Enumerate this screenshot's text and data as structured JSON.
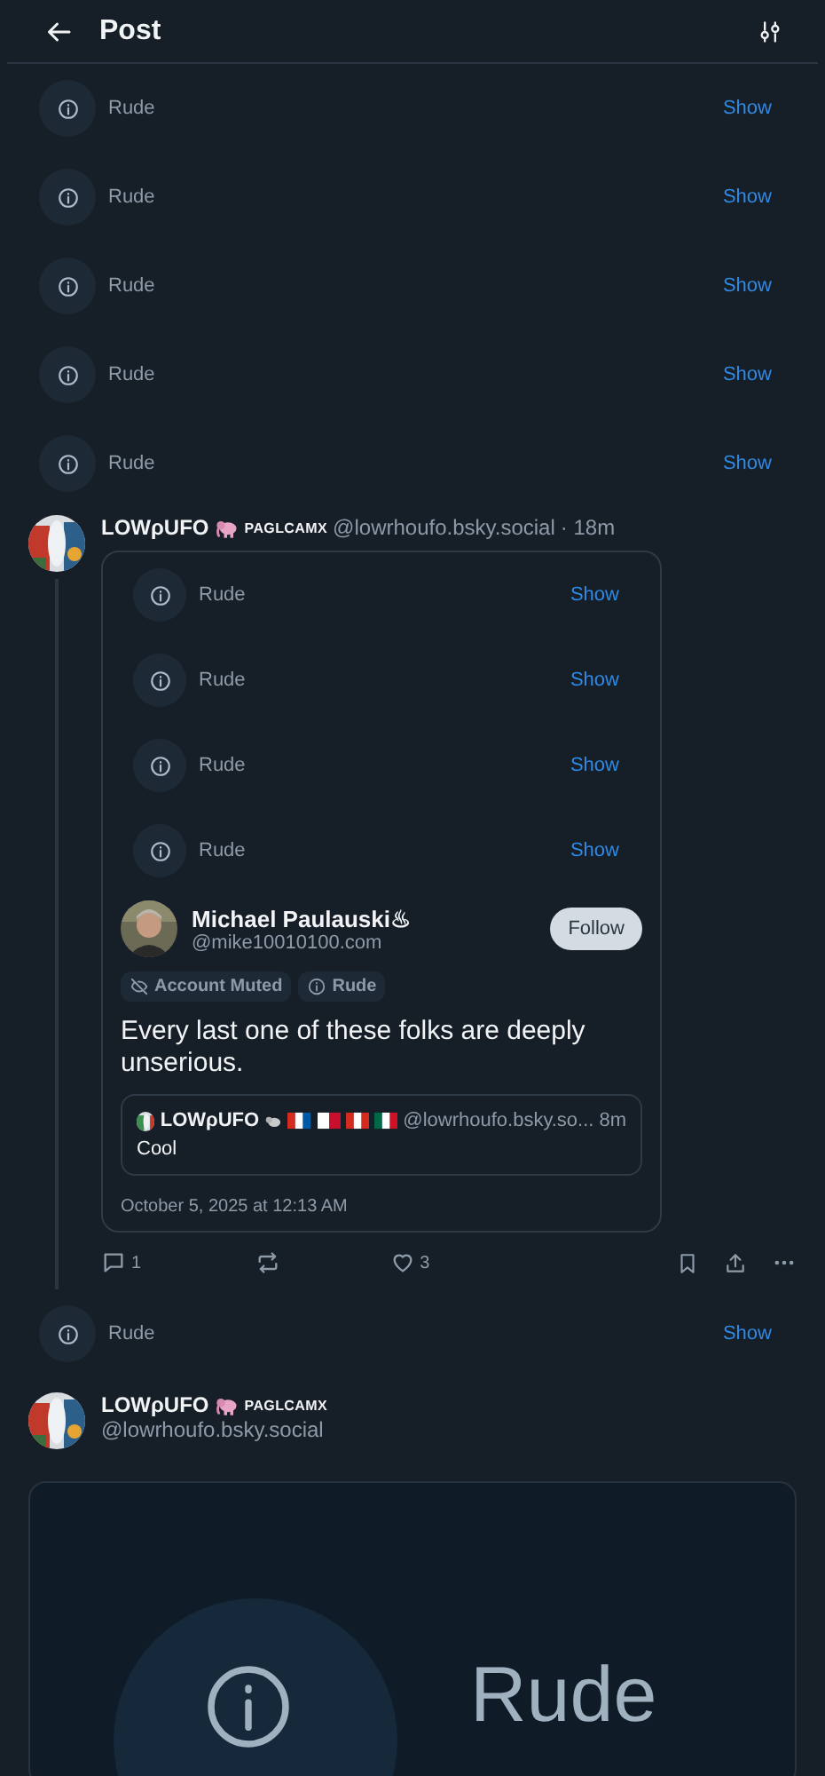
{
  "header": {
    "title": "Post"
  },
  "hidden_replies": [
    {
      "label": "Rude",
      "action": "Show"
    },
    {
      "label": "Rude",
      "action": "Show"
    },
    {
      "label": "Rude",
      "action": "Show"
    },
    {
      "label": "Rude",
      "action": "Show"
    },
    {
      "label": "Rude",
      "action": "Show"
    }
  ],
  "post": {
    "display_name": "LOWρUFO",
    "badge_text": "PAGLCAMX",
    "handle": "@lowrhoufo.bsky.social",
    "time": "· 18m",
    "quote": {
      "hidden_replies": [
        {
          "label": "Rude",
          "action": "Show"
        },
        {
          "label": "Rude",
          "action": "Show"
        },
        {
          "label": "Rude",
          "action": "Show"
        },
        {
          "label": "Rude",
          "action": "Show"
        }
      ],
      "author": {
        "display_name": "Michael Paulauski♨",
        "handle": "@mike10010100.com",
        "follow": "Follow"
      },
      "labels": [
        {
          "kind": "muted",
          "text": "Account Muted"
        },
        {
          "kind": "info",
          "text": "Rude"
        }
      ],
      "text": "Every last one of these folks are deeply unserious.",
      "embed": {
        "display_name": "LOWρUFO",
        "handle": "@lowrhoufo.bsky.so...",
        "time": "8m",
        "text": "Cool"
      },
      "date": "October 5, 2025 at 12:13 AM"
    },
    "actions": {
      "replies": "1",
      "likes": "3"
    }
  },
  "hidden_reply": {
    "label": "Rude",
    "action": "Show"
  },
  "next_post": {
    "display_name": "LOWρUFO",
    "badge_text": "PAGLCAMX",
    "handle": "@lowrhoufo.bsky.social",
    "image_text": "Rude"
  }
}
